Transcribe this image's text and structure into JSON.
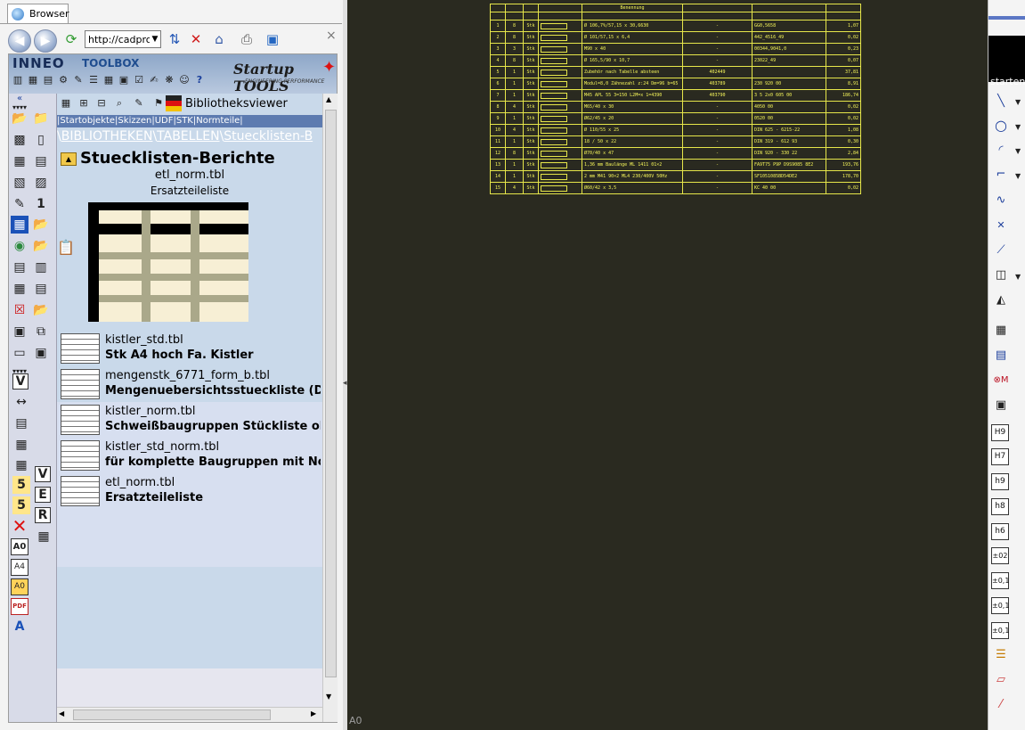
{
  "browser": {
    "tab_label": "Browser",
    "url": "http://cadproe",
    "close_glyph": "×"
  },
  "banner": {
    "brand": "INNEO",
    "toolbox": "TOOLBOX",
    "startup": "Startup TOOLS",
    "startup_sub": "ENGINEERING PERFORMANCE"
  },
  "viewer": {
    "bibliotheksviewer": "Bibliotheksviewer",
    "links": "|Startobjekte|Skizzen|UDF|STK|Normteile|",
    "breadcrumb": [
      "BIBLIOTHEKEN",
      "TABELLEN",
      "Stuecklisten-B"
    ],
    "section_title": "Stuecklisten-Berichte",
    "selected_file": "etl_norm.tbl",
    "selected_desc": "Ersatzteileliste",
    "items": [
      {
        "file": "kistler_std.tbl",
        "desc": "Stk A4 hoch Fa. Kistler"
      },
      {
        "file": "mengenstk_6771_form_b.tbl",
        "desc": "Mengenuebersichtsstueckliste (D"
      },
      {
        "file": "kistler_norm.tbl",
        "desc": "Schweißbaugruppen Stückliste oh"
      },
      {
        "file": "kistler_std_norm.tbl",
        "desc": "für komplette Baugruppen mit No"
      },
      {
        "file": "etl_norm.tbl",
        "desc": "Ersatzteileliste"
      }
    ]
  },
  "left_toolbar_labels": [
    "1",
    "V",
    "5",
    "5",
    "V",
    "E",
    "R",
    "A0",
    "A4",
    "A0",
    "PDF"
  ],
  "cad": {
    "sheet_label": "A0",
    "bom_rows": [
      [
        "1",
        "8",
        "Stk",
        "Ø 106,7%/57,15 x 30,6630",
        "-",
        "GG0,5658",
        "1,07"
      ],
      [
        "2",
        "8",
        "Stk",
        "Ø 101/57,15 x 6,4",
        "-",
        "442_4516_49",
        "0,02"
      ],
      [
        "3",
        "3",
        "Stk",
        "M90 x 40",
        "-",
        "00344,9041,0",
        "0,23"
      ],
      [
        "4",
        "8",
        "Stk",
        "Ø 165,5/90 x 10,7",
        "-",
        "23022_49",
        "0,07"
      ],
      [
        "5",
        "1",
        "Stk",
        "Zubehör nach Tabelle absteen",
        "402449",
        "",
        "37,81"
      ],
      [
        "6",
        "1",
        "Stk",
        "Modul=8,0 Zähnezahl z:24 Dm=96 b=65",
        "403789",
        "230 920 00",
        "8,91"
      ],
      [
        "7",
        "1",
        "Stk",
        "M45 APL 55 3=150 L2M=x 1=4390",
        "403790",
        "3 5 2x0 605 00",
        "186,74"
      ],
      [
        "8",
        "4",
        "Stk",
        "M65/40 x 30",
        "-",
        "4050 00",
        "0,02"
      ],
      [
        "9",
        "1",
        "Stk",
        "Ø62/45 x 20",
        "-",
        "0520 00",
        "0,02"
      ],
      [
        "10",
        "4",
        "Stk",
        "Ø 110/55 x 25",
        "-",
        "DIN 625 - 6215-22",
        "1,08"
      ],
      [
        "11",
        "1",
        "Stk",
        "18 / 50 x 22",
        "-",
        "DIN 319 - 612 93",
        "0,30"
      ],
      [
        "12",
        "8",
        "Stk",
        "Ø70/40 x 47",
        "-",
        "DIN 920 - 330 22",
        "2,84"
      ],
      [
        "13",
        "1",
        "Stk",
        "1,36 mm Baulänge ML 1411 01×2",
        "-",
        "FA9T75 P9P D9S9085 8E2",
        "193,76"
      ],
      [
        "14",
        "1",
        "Stk",
        "2 mm M41 90×2 ML4 230/400V 50Hz",
        "-",
        "SF1051085BD54DE2",
        "178,70"
      ],
      [
        "15",
        "4",
        "Stk",
        "Ø60/42 x 3,5",
        "-",
        "KC 40 00",
        "0,02"
      ]
    ],
    "bom_header_text": "Benennung"
  },
  "right_panel": {
    "title": "starten...",
    "buttons": [
      "H9",
      "H7",
      "h9",
      "h8",
      "h6",
      "±02",
      "±0,1",
      "±0,1",
      "±0,1"
    ]
  },
  "colors": {
    "cad_background": "#2a2a20",
    "bom_lines": "#e6e64a",
    "link_bar": "#5d7bb0"
  }
}
